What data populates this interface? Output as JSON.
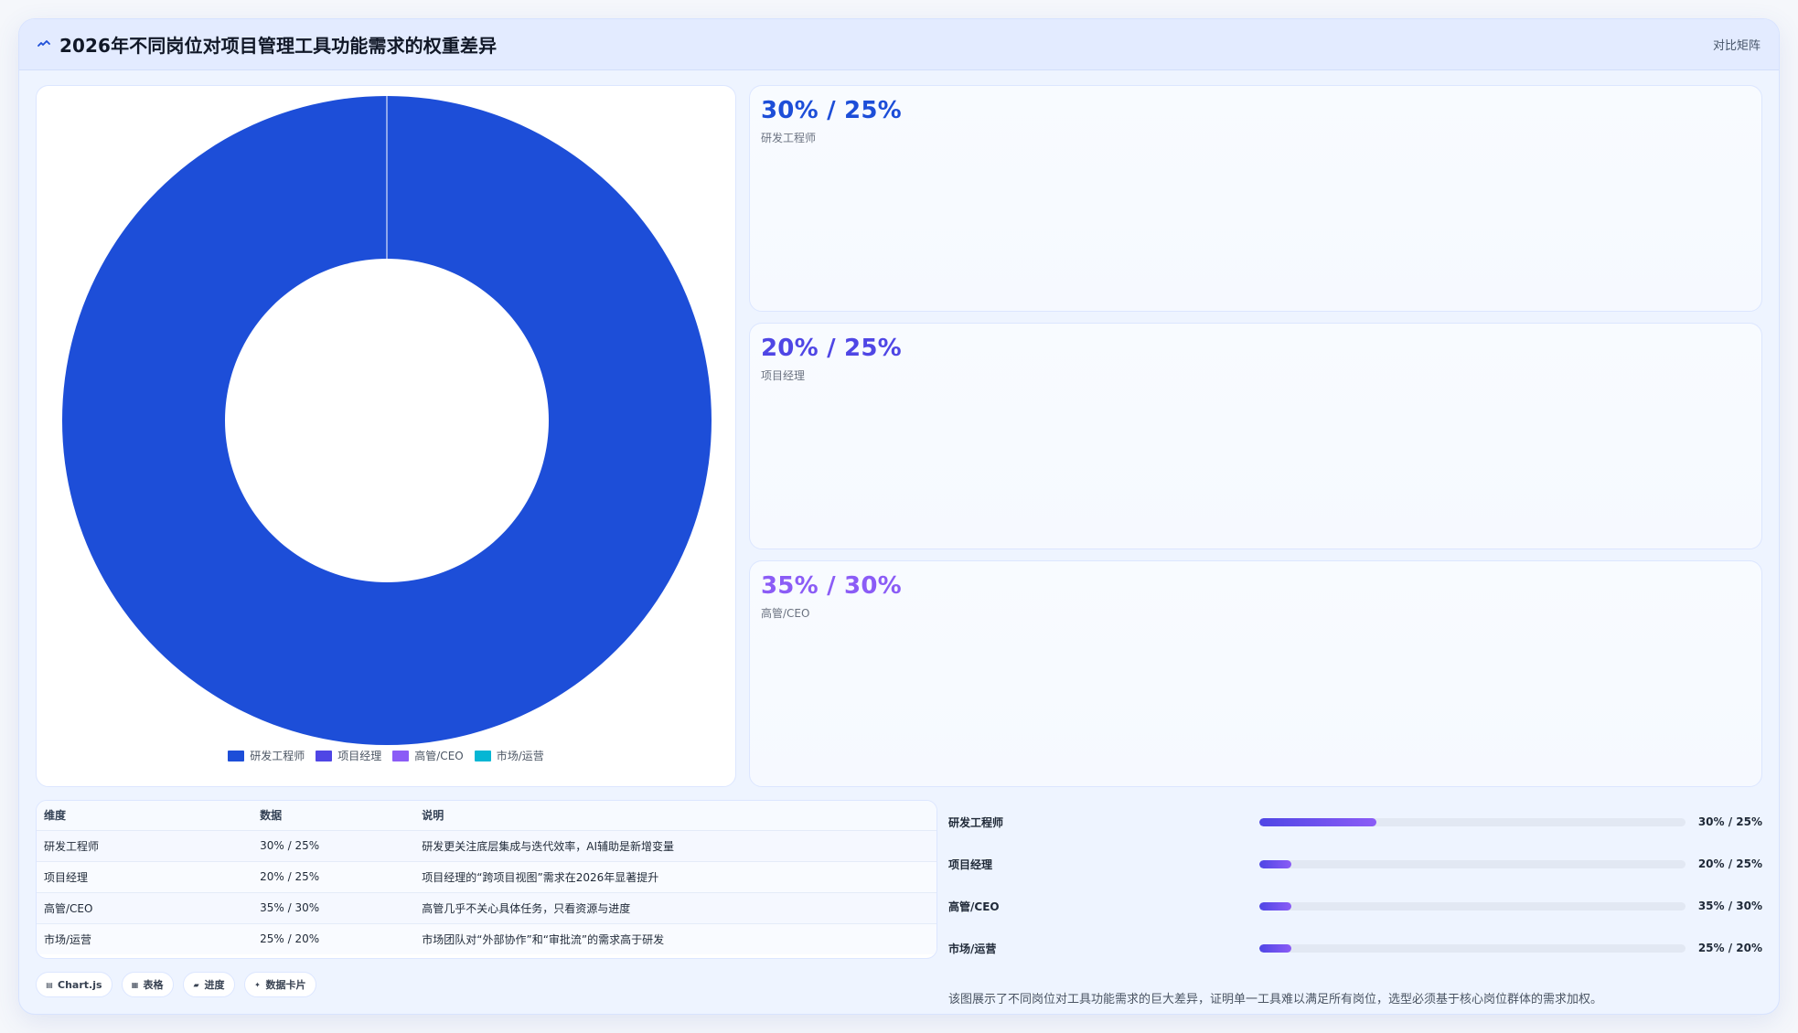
{
  "header": {
    "title": "2026年不同岗位对项目管理工具功能需求的权重差异",
    "right_label": "对比矩阵",
    "icon": "chart-line-icon"
  },
  "cards": [
    {
      "value": "30% / 25%",
      "label": "研发工程师",
      "color": "#1D4ED8"
    },
    {
      "value": "20% / 25%",
      "label": "项目经理",
      "color": "#4F46E5"
    },
    {
      "value": "35% / 30%",
      "label": "高管/CEO",
      "color": "#8B5CF6"
    }
  ],
  "table": {
    "headers": [
      "维度",
      "数据",
      "说明"
    ],
    "rows": [
      {
        "dimension": "研发工程师",
        "data": "30% / 25%",
        "note": "研发更关注底层集成与迭代效率，AI辅助是新增变量"
      },
      {
        "dimension": "项目经理",
        "data": "20% / 25%",
        "note": "项目经理的“跨项目视图”需求在2026年显著提升"
      },
      {
        "dimension": "高管/CEO",
        "data": "35% / 30%",
        "note": "高管几乎不关心具体任务，只看资源与进度"
      },
      {
        "dimension": "市场/运营",
        "data": "25% / 20%",
        "note": "市场团队对“外部协作”和“审批流”的需求高于研发"
      }
    ]
  },
  "chips": [
    {
      "icon": "chart-icon",
      "label": "Chart.js"
    },
    {
      "icon": "table-icon",
      "label": "表格"
    },
    {
      "icon": "progress-icon",
      "label": "进度"
    },
    {
      "icon": "card-icon",
      "label": "数据卡片"
    }
  ],
  "progress": {
    "items": [
      {
        "label": "研发工程师",
        "value_text": "30% / 25%",
        "fill": 0.275
      },
      {
        "label": "项目经理",
        "value_text": "20% / 25%",
        "fill": 0.075
      },
      {
        "label": "高管/CEO",
        "value_text": "35% / 30%",
        "fill": 0.075
      },
      {
        "label": "市场/运营",
        "value_text": "25% / 20%",
        "fill": 0.075
      }
    ],
    "summary": "该图展示了不同岗位对工具功能需求的巨大差异，证明单一工具难以满足所有岗位，选型必须基于核心岗位群体的需求加权。"
  },
  "chart_data": {
    "type": "pie",
    "categories": [
      "研发工程师",
      "项目经理",
      "高管/CEO",
      "市场/运营"
    ],
    "values": [
      100,
      0,
      0,
      0
    ],
    "colors": [
      "#1D4ED8",
      "#4F46E5",
      "#8B5CF6",
      "#06B6D4"
    ],
    "legend_position": "bottom",
    "donut": true
  },
  "colors": {
    "accent_blue": "#1D4ED8",
    "accent_indigo": "#4F46E5",
    "accent_purple": "#8B5CF6",
    "accent_teal": "#06B6D4"
  }
}
